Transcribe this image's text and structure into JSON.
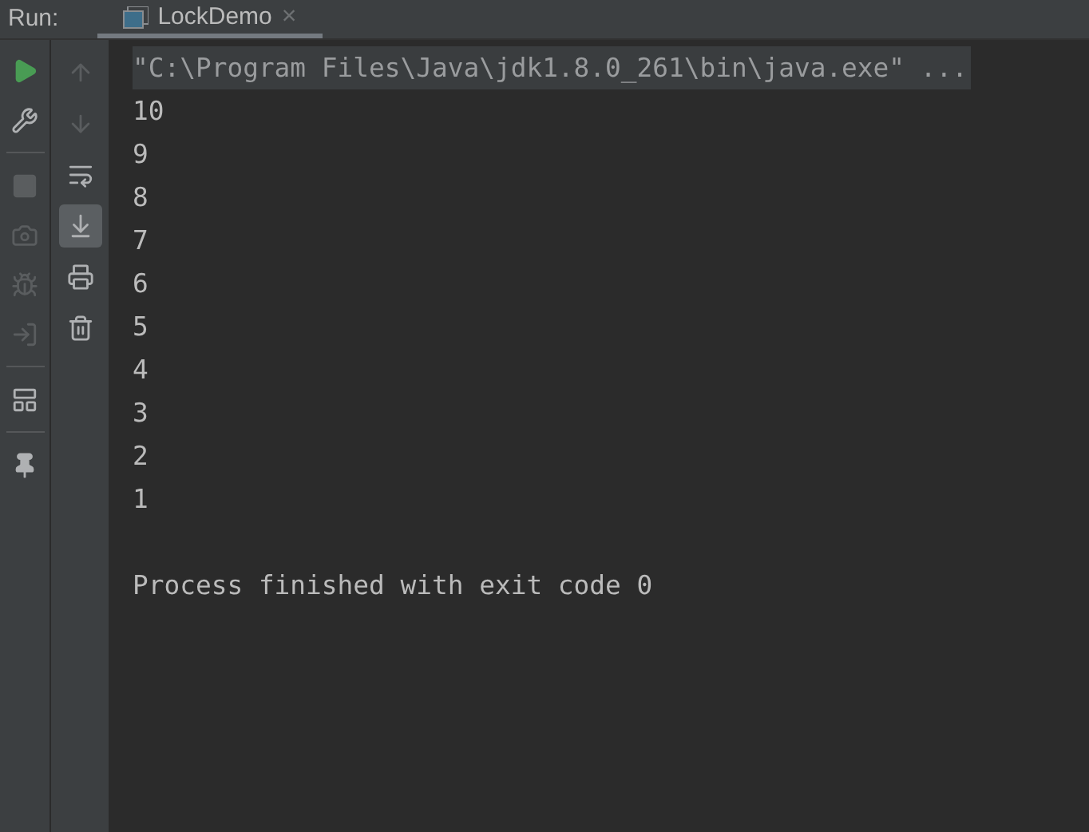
{
  "run_panel": {
    "label": "Run:"
  },
  "tabs": [
    {
      "label": "LockDemo",
      "selected": true,
      "close": "×"
    }
  ],
  "left_toolbar": [
    {
      "disabled": false
    },
    {
      "disabled": false
    },
    {
      "disabled": true
    },
    {
      "disabled": true
    },
    {
      "disabled": true
    },
    {
      "disabled": true
    },
    {
      "disabled": false
    },
    {
      "disabled": false
    }
  ],
  "console_toolbar": [
    {
      "disabled": true,
      "selected": false
    },
    {
      "disabled": true,
      "selected": false
    },
    {
      "disabled": false,
      "selected": false
    },
    {
      "disabled": false,
      "selected": true
    },
    {
      "disabled": false,
      "selected": false
    },
    {
      "disabled": false,
      "selected": false
    }
  ],
  "console": [
    {
      "kind": "command",
      "text": "\"C:\\Program Files\\Java\\jdk1.8.0_261\\bin\\java.exe\" ..."
    },
    {
      "kind": "output",
      "text": "10"
    },
    {
      "kind": "output",
      "text": "9"
    },
    {
      "kind": "output",
      "text": "8"
    },
    {
      "kind": "output",
      "text": "7"
    },
    {
      "kind": "output",
      "text": "6"
    },
    {
      "kind": "output",
      "text": "5"
    },
    {
      "kind": "output",
      "text": "4"
    },
    {
      "kind": "output",
      "text": "3"
    },
    {
      "kind": "output",
      "text": "2"
    },
    {
      "kind": "output",
      "text": "1"
    },
    {
      "kind": "system",
      "text": "Process finished with exit code 0"
    }
  ]
}
